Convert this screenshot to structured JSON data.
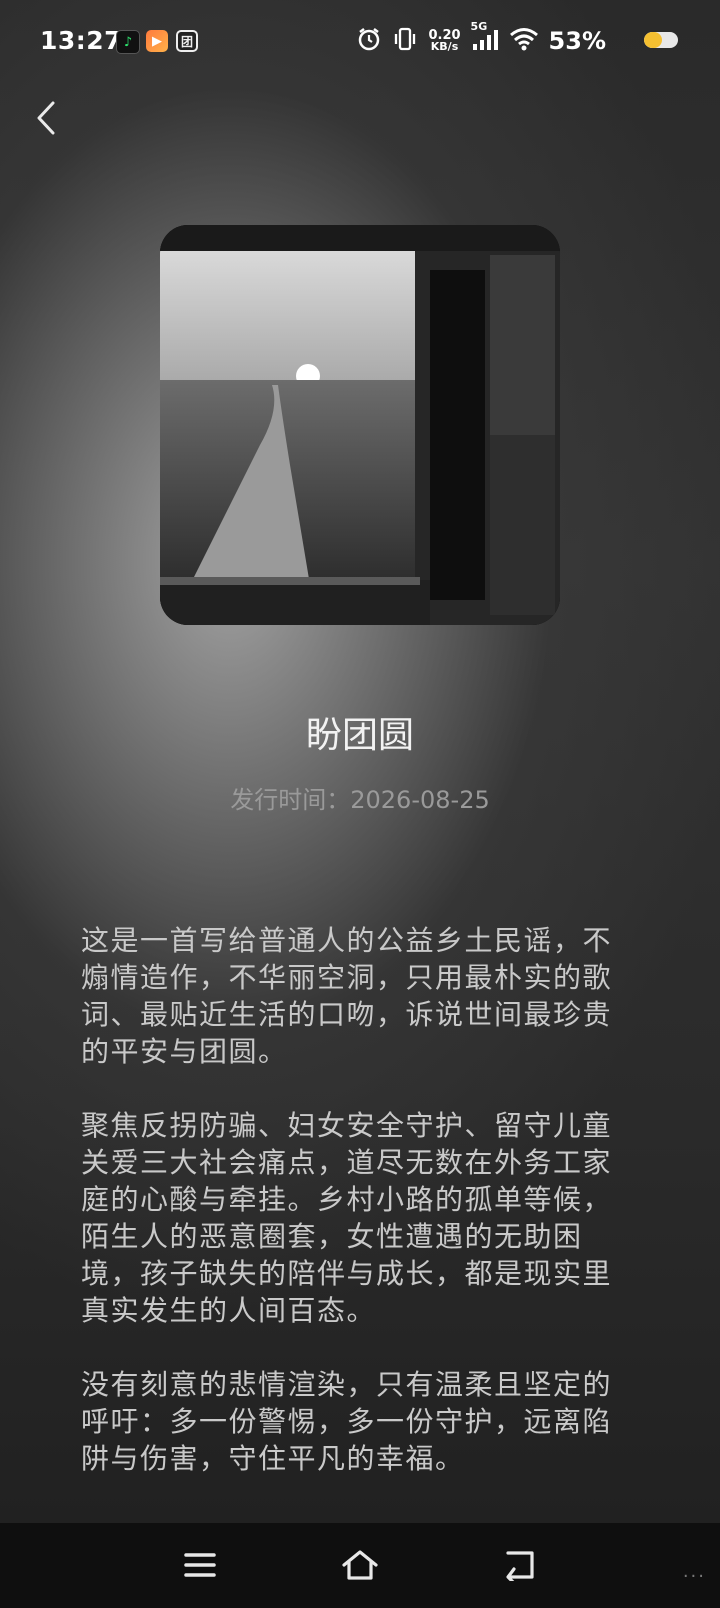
{
  "status_bar": {
    "time": "13:27",
    "net_speed_value": "0.20",
    "net_speed_unit": "KB/s",
    "network": "5G",
    "battery": "53%",
    "battery_level": 0.53,
    "battery_color": "#f5c031",
    "icons": [
      "music-app-icon",
      "video-app-icon",
      "tuan-app-icon",
      "alarm-icon",
      "vibrate-icon",
      "signal-icon",
      "wifi-icon",
      "battery-icon"
    ],
    "tuan_glyph": "团"
  },
  "song": {
    "title": "盼团圆",
    "release_label": "发行时间：",
    "release_date": "2026-08-25"
  },
  "description": {
    "paragraphs": [
      "这是一首写给普通人的公益乡土民谣，不煽情造作，不华丽空洞，只用最朴实的歌词、最贴近生活的口吻，诉说世间最珍贵的平安与团圆。",
      "聚焦反拐防骗、妇女安全守护、留守儿童关爱三大社会痛点，道尽无数在外务工家庭的心酸与牵挂。乡村小路的孤单等候，陌生人的恶意圈套，女性遭遇的无助困境，孩子缺失的陪伴与成长，都是现实里真实发生的人间百态。",
      "没有刻意的悲情渲染，只有温柔且坚定的呼吁：多一份警惕，多一份守护，远离陷阱与伤害，守住平凡的幸福。"
    ]
  },
  "nav": {
    "icons": [
      "menu-icon",
      "home-icon",
      "back-nav-icon"
    ]
  },
  "watermark": "···"
}
